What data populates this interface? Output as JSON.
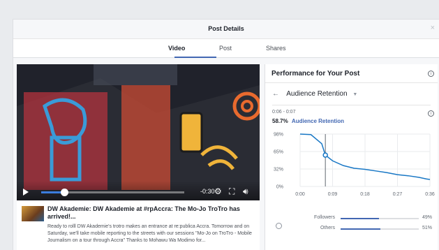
{
  "modal": {
    "title": "Post Details",
    "close_glyph": "×"
  },
  "tabs": [
    {
      "label": "Video",
      "active": true
    },
    {
      "label": "Post",
      "active": false
    },
    {
      "label": "Shares",
      "active": false
    }
  ],
  "player": {
    "time_remaining": "-0:30",
    "progress": 0.16
  },
  "post": {
    "title": "DW Akademie: DW Akademie at #rpAccra: The Mo-Jo TroTro has arrived!...",
    "description": "Ready to rolll DW Akademie's trotro makes an entrance at re:publica Accra. Tomorrow and on Saturday, we'll take mobile reporting to the streets with our sessions \"Mo-Jo on TroTro - Mobile Journalism on a tour through Accra\" Thanks to Mohawu Wa Modimo for..."
  },
  "performance": {
    "title": "Performance for Your Post",
    "info_glyph": "i",
    "back_glyph": "←",
    "metric_label": "Audience Retention",
    "caret_glyph": "▼",
    "range": "0:06 - 0:07",
    "stat_value": "58.7%",
    "stat_label": "Audience Retention"
  },
  "chart_data": {
    "type": "line",
    "x_ticks": [
      "0:00",
      "0:09",
      "0:18",
      "0:27",
      "0:36"
    ],
    "y_ticks": [
      "98%",
      "65%",
      "32%",
      "0%"
    ],
    "x_seconds": [
      0,
      3,
      6,
      7,
      9,
      12,
      15,
      18,
      21,
      24,
      27,
      30,
      33,
      35,
      36
    ],
    "y": [
      98,
      97,
      80,
      58.7,
      48,
      39,
      34,
      32,
      29,
      26,
      22,
      20,
      17,
      14,
      13
    ],
    "marker_x": 7,
    "xlim": [
      0,
      36
    ],
    "ylim": [
      0,
      98
    ],
    "color": "#1877c5",
    "grid": true
  },
  "audience": [
    {
      "label": "Followers",
      "value": 49,
      "pct": "49%"
    },
    {
      "label": "Others",
      "value": 51,
      "pct": "51%"
    }
  ],
  "colors": {
    "accent": "#4267b2",
    "line": "#1877c5"
  }
}
